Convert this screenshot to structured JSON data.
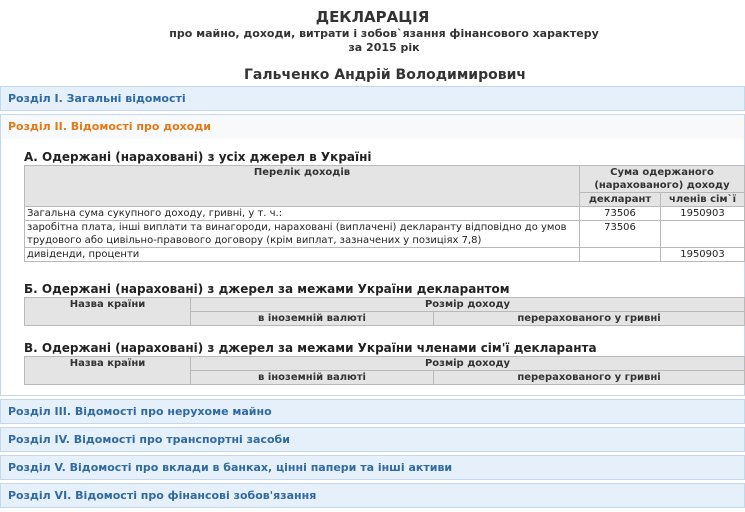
{
  "header": {
    "title": "ДЕКЛАРАЦІЯ",
    "subtitle_line1": "про майно, доходи, витрати і зобов`язання фінансового характеру",
    "subtitle_line2": "за 2015 рік",
    "person_name": "Гальченко Андрій Володимирович"
  },
  "sections": {
    "s1": "Розділ I. Загальні відомості",
    "s2": "Розділ II. Відомості про доходи",
    "s3": "Розділ III. Відомості про нерухоме майно",
    "s4": "Розділ IV. Відомості про транспортні засоби",
    "s5": "Розділ V. Відомості про вклади в банках, цінні папери та інші активи",
    "s6": "Розділ VI. Відомості про фінансові зобов'язання"
  },
  "income_a": {
    "heading": "А. Одержані (нараховані) з усіх джерел в Україні",
    "col_list": "Перелік доходів",
    "col_sum": "Сума одержаного (нарахованого) доходу",
    "col_declarant": "декларант",
    "col_family": "членів сім`ї",
    "rows": [
      {
        "label": "Загальна сума сукупного доходу, гривні, у т. ч.:",
        "declarant": "73506",
        "family": "1950903"
      },
      {
        "label": "заробітна плата, інші виплати та винагороди, нараховані (виплачені) декларанту відповідно до умов трудового або цивільно-правового договору (крім виплат, зазначених у позиціях 7,8)",
        "declarant": "73506",
        "family": ""
      },
      {
        "label": "дивіденди, проценти",
        "declarant": "",
        "family": "1950903"
      }
    ]
  },
  "income_b": {
    "heading": "Б. Одержані (нараховані) з джерел за межами України декларантом",
    "col_country": "Назва країни",
    "col_amount": "Розмір доходу",
    "col_foreign": "в іноземній валюті",
    "col_uah": "перерахованого у гривні"
  },
  "income_c": {
    "heading": "В. Одержані (нараховані) з джерел за межами України членами сім'ї декларанта",
    "col_country": "Назва країни",
    "col_amount": "Розмір доходу",
    "col_foreign": "в іноземній валюті",
    "col_uah": "перерахованого у гривні"
  }
}
